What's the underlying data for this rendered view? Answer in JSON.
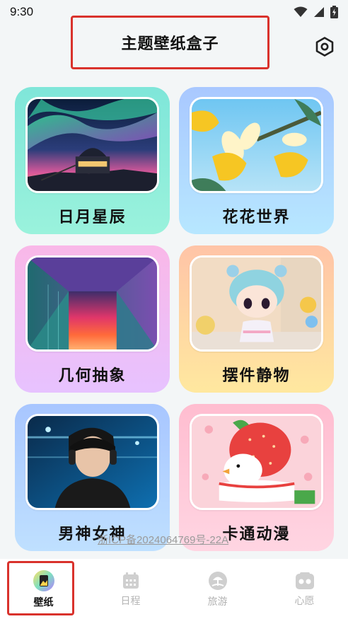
{
  "status_bar": {
    "time": "9:30"
  },
  "header": {
    "title": "主题壁纸盒子",
    "settings_icon": "settings-gear-icon"
  },
  "categories": [
    {
      "label": "日月星辰",
      "image": "aurora-observatory"
    },
    {
      "label": "花花世界",
      "image": "daffodils-blue-sky"
    },
    {
      "label": "几何抽象",
      "image": "neon-corridor"
    },
    {
      "label": "摆件静物",
      "image": "doll-figurine"
    },
    {
      "label": "男神女神",
      "image": "man-headphones-city"
    },
    {
      "label": "卡通动漫",
      "image": "strawberry-duck-cartoon"
    }
  ],
  "footer": {
    "icp": "浙ICP备2024064769号-22A"
  },
  "bottom_nav": {
    "items": [
      {
        "label": "壁纸",
        "icon": "wallpaper-icon",
        "active": true
      },
      {
        "label": "日程",
        "icon": "calendar-icon",
        "active": false
      },
      {
        "label": "旅游",
        "icon": "travel-icon",
        "active": false
      },
      {
        "label": "心愿",
        "icon": "wish-icon",
        "active": false
      }
    ]
  },
  "colors": {
    "highlight_border": "#d9322c",
    "inactive_nav": "#b3b3b3"
  }
}
